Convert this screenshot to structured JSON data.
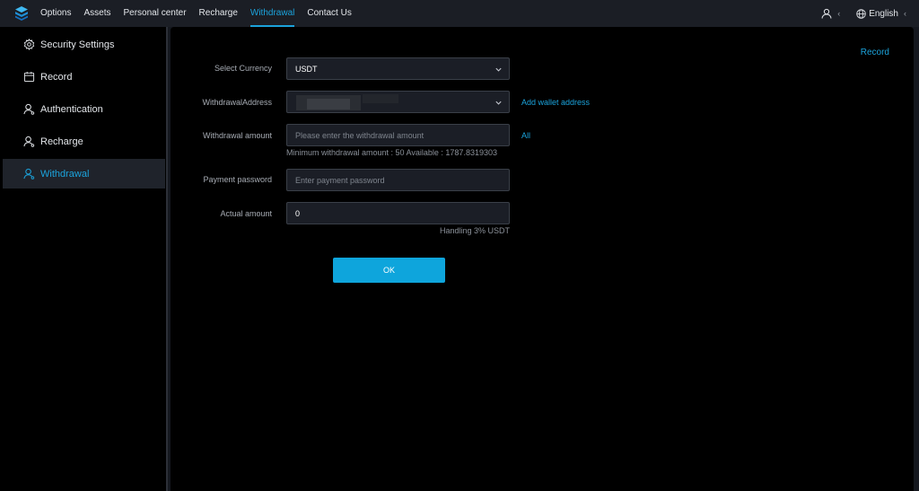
{
  "nav": {
    "items": [
      {
        "label": "Options"
      },
      {
        "label": "Assets"
      },
      {
        "label": "Personal center"
      },
      {
        "label": "Recharge"
      },
      {
        "label": "Withdrawal",
        "active": true
      },
      {
        "label": "Contact Us"
      }
    ],
    "language": "English",
    "icons": {
      "logo": "stack-logo-icon",
      "user": "user-icon",
      "globe": "globe-icon"
    }
  },
  "sidebar": {
    "items": [
      {
        "label": "Security Settings",
        "icon": "gear-icon"
      },
      {
        "label": "Record",
        "icon": "calendar-icon"
      },
      {
        "label": "Authentication",
        "icon": "user-icon"
      },
      {
        "label": "Recharge",
        "icon": "user-icon"
      },
      {
        "label": "Withdrawal",
        "icon": "user-icon",
        "active": true
      }
    ]
  },
  "form": {
    "record_link": "Record",
    "currency": {
      "label": "Select Currency",
      "value": "USDT"
    },
    "address": {
      "label": "WithdrawalAddress",
      "value": "",
      "add_link": "Add wallet address"
    },
    "amount": {
      "label": "Withdrawal amount",
      "placeholder": "Please enter the withdrawal amount",
      "all_link": "All",
      "hint": "Minimum withdrawal amount : 50  Available : 1787.8319303"
    },
    "password": {
      "label": "Payment password",
      "placeholder": "Enter payment password"
    },
    "actual": {
      "label": "Actual amount",
      "value": "0",
      "hint": "Handling 3% USDT"
    },
    "ok_label": "OK"
  },
  "colors": {
    "accent": "#1ba3dc",
    "button": "#0ea5dc",
    "background": "#000000",
    "topbar": "#1b1e25"
  }
}
